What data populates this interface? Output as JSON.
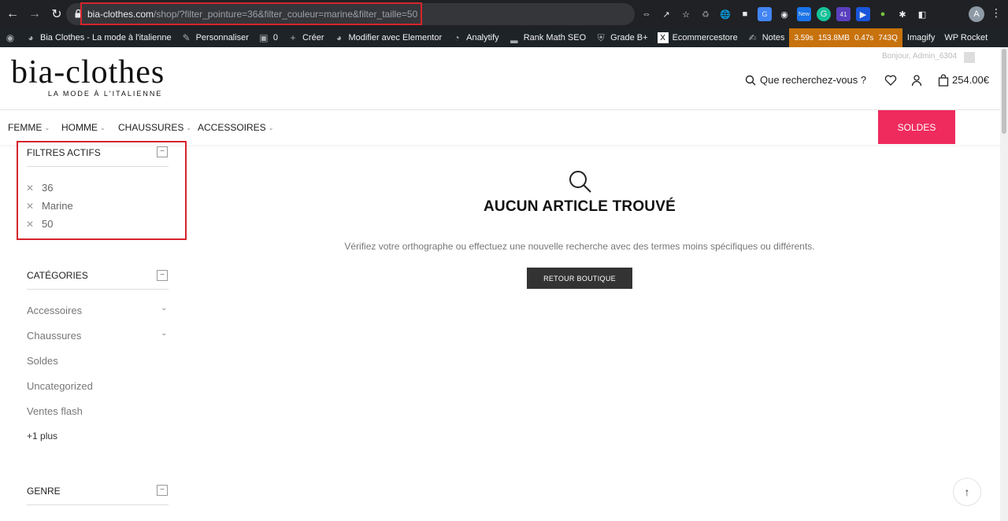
{
  "browser": {
    "url_host": "bia-clothes.com",
    "url_path": "/shop/?filter_pointure=36&filter_couleur=marine&filter_taille=50",
    "profile_initial": "A",
    "ext_badge_new": "New",
    "ext_badge_count": "41"
  },
  "wp_admin_bar": {
    "site_name": "Bia Clothes - La mode à l'italienne",
    "customize": "Personnaliser",
    "comments_count": "0",
    "new": "Créer",
    "elementor": "Modifier avec Elementor",
    "analytify": "Analytify",
    "rankmath": "Rank Math SEO",
    "grade": "Grade B+",
    "ecommercestore": "Ecommercestore",
    "notes": "Notes",
    "perf": [
      "3.59s",
      "153.8MB",
      "0.47s",
      "743Q"
    ],
    "imagify": "Imagify",
    "wprocket": "WP Rocket"
  },
  "header": {
    "logo_main": "bia-clothes",
    "logo_sub": "LA MODE À L'ITALIENNE",
    "greeting": "Bonjour, Admin_6304",
    "search_label": "Que recherchez-vous ?",
    "cart_total": "254.00€"
  },
  "nav": {
    "items": [
      "FEMME",
      "HOMME",
      "CHAUSSURES",
      "ACCESSOIRES"
    ],
    "sale_label": "SOLDES"
  },
  "sidebar": {
    "active_filters_title": "FILTRES ACTIFS",
    "active_filters": [
      "36",
      "Marine",
      "50"
    ],
    "categories_title": "CATÉGORIES",
    "categories": [
      "Accessoires",
      "Chaussures",
      "Soldes",
      "Uncategorized",
      "Ventes flash"
    ],
    "more_label": "+1 plus",
    "genre_title": "GENRE"
  },
  "main": {
    "empty_title": "AUCUN ARTICLE TROUVÉ",
    "empty_message": "Vérifiez votre orthographe ou effectuez une nouvelle recherche avec des termes moins spécifiques ou différents.",
    "back_button": "RETOUR BOUTIQUE"
  },
  "colors": {
    "sale": "#ef2b5e",
    "highlight": "#d6242c",
    "wp_bar": "#1d2327",
    "browser_bar": "#202124"
  }
}
